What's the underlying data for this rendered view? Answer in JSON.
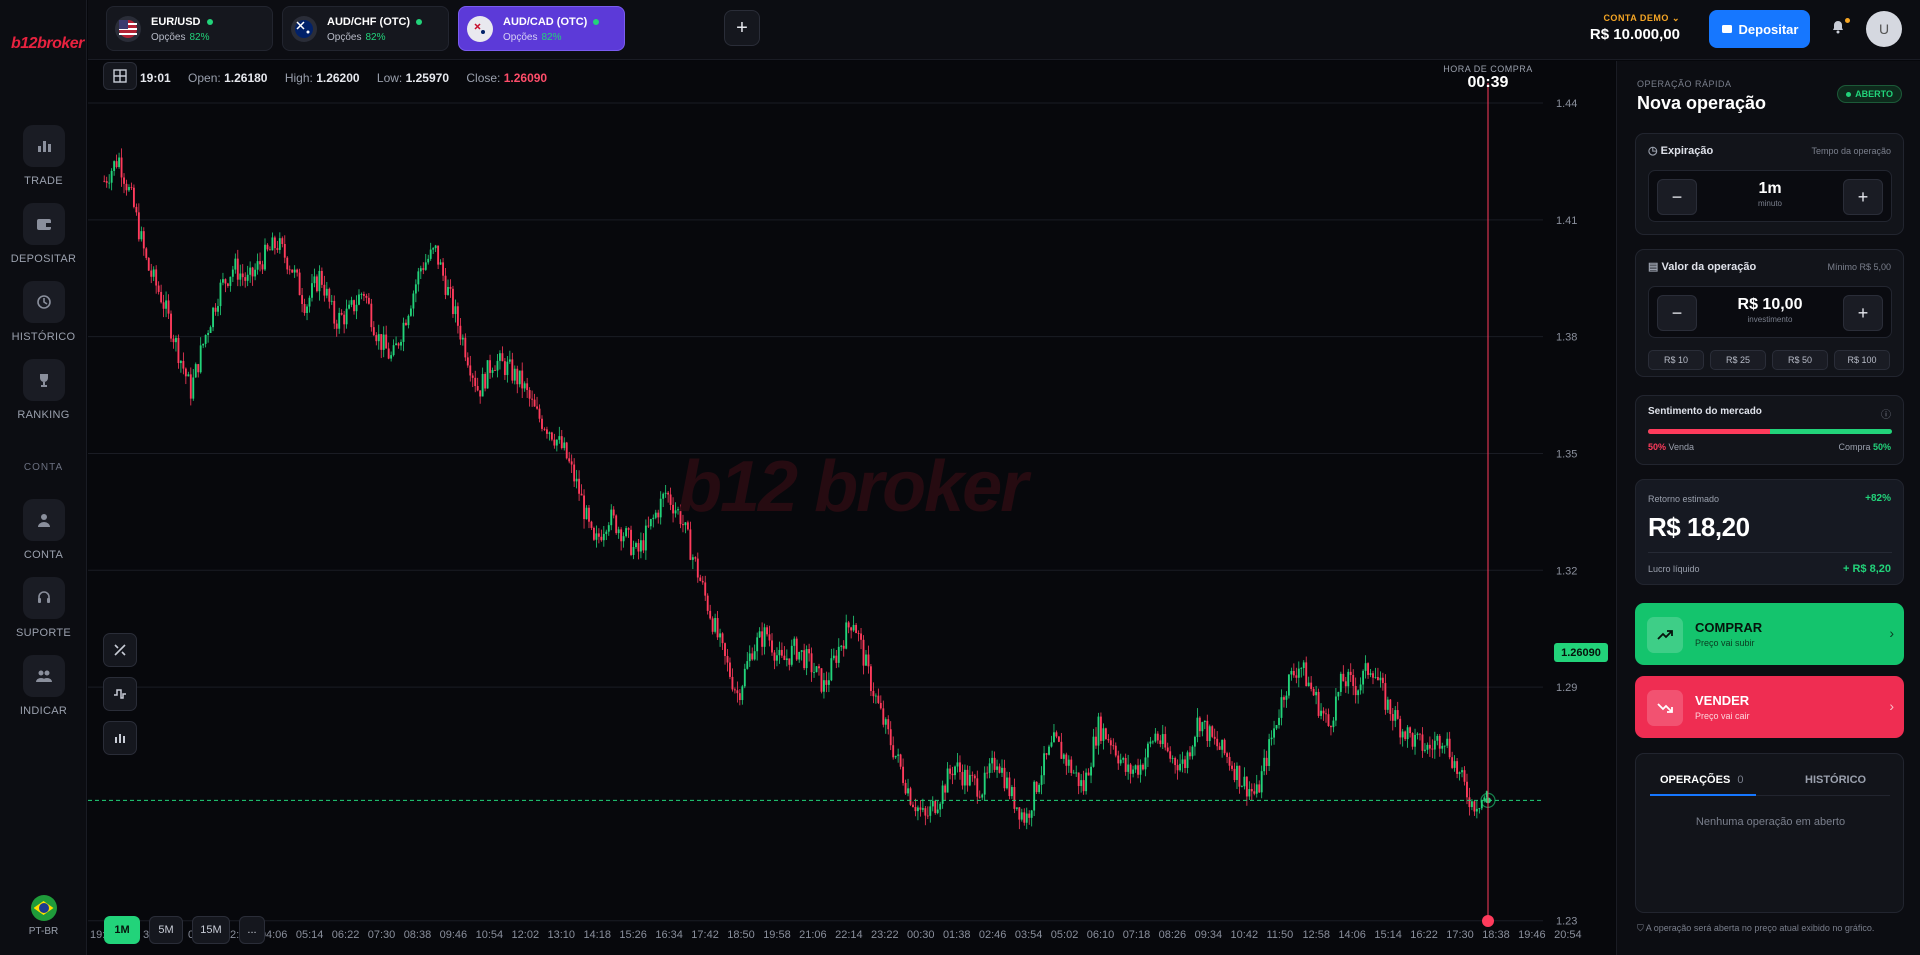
{
  "brand": {
    "logo": "b12broker",
    "watermark": "b12 broker"
  },
  "nav": {
    "items": [
      {
        "label": "TRADE",
        "icon": "bar-chart-icon"
      },
      {
        "label": "DEPOSITAR",
        "icon": "wallet-icon"
      },
      {
        "label": "HISTÓRICO",
        "icon": "history-icon"
      },
      {
        "label": "RANKING",
        "icon": "trophy-icon"
      }
    ],
    "section": "CONTA",
    "account_items": [
      {
        "label": "CONTA",
        "icon": "user-icon"
      },
      {
        "label": "SUPORTE",
        "icon": "headset-icon"
      },
      {
        "label": "INDICAR",
        "icon": "users-icon"
      }
    ],
    "language": "PT-BR"
  },
  "assets": [
    {
      "name": "EUR/USD",
      "sub": "Opções",
      "payout": "82%",
      "active": false
    },
    {
      "name": "AUD/CHF (OTC)",
      "sub": "Opções",
      "payout": "82%",
      "active": false
    },
    {
      "name": "AUD/CAD (OTC)",
      "sub": "Opções",
      "payout": "82%",
      "active": true
    }
  ],
  "header": {
    "demo_label": "CONTA DEMO",
    "balance": "R$ 10.000,00",
    "deposit_label": "Depositar",
    "avatar": "U"
  },
  "chart": {
    "ohlc": {
      "time": "19:01",
      "open_label": "Open:",
      "open": "1.26180",
      "high_label": "High:",
      "high": "1.26200",
      "low_label": "Low:",
      "low": "1.25970",
      "close_label": "Close:",
      "close": "1.26090"
    },
    "purchase_label": "HORA DE COMPRA",
    "purchase_time": "00:39",
    "current_price": "1.26090",
    "timeframes": [
      "1M",
      "5M",
      "15M",
      "..."
    ],
    "active_timeframe": "1M"
  },
  "chart_data": {
    "type": "candlestick",
    "y_ticks": [
      "1.44",
      "1.41",
      "1.38",
      "1.35",
      "1.32",
      "1.29",
      "1.23"
    ],
    "ylim": [
      1.23,
      1.44
    ],
    "x_ticks": [
      "19:",
      "0",
      "2",
      "32",
      "01:50",
      "02:58",
      "04:06",
      "05:14",
      "06:22",
      "07:30",
      "08:38",
      "09:46",
      "10:54",
      "12:02",
      "13:10",
      "14:18",
      "15:26",
      "16:34",
      "17:42",
      "18:50",
      "19:58",
      "21:06",
      "22:14",
      "23:22",
      "00:30",
      "01:38",
      "02:46",
      "03:54",
      "05:02",
      "06:10",
      "07:18",
      "08:26",
      "09:34",
      "10:42",
      "11:50",
      "12:58",
      "14:06",
      "15:14",
      "16:22",
      "17:30",
      "18:38",
      "19:46",
      "20:54"
    ],
    "price_path": [
      1.42,
      1.426,
      1.414,
      1.398,
      1.39,
      1.378,
      1.366,
      1.38,
      1.392,
      1.398,
      1.394,
      1.4,
      1.404,
      1.398,
      1.388,
      1.396,
      1.384,
      1.386,
      1.392,
      1.38,
      1.374,
      1.386,
      1.398,
      1.402,
      1.39,
      1.378,
      1.366,
      1.374,
      1.372,
      1.368,
      1.36,
      1.356,
      1.35,
      1.34,
      1.326,
      1.334,
      1.33,
      1.324,
      1.332,
      1.34,
      1.334,
      1.322,
      1.31,
      1.298,
      1.288,
      1.3,
      1.304,
      1.296,
      1.3,
      1.296,
      1.29,
      1.3,
      1.308,
      1.294,
      1.282,
      1.272,
      1.262,
      1.256,
      1.262,
      1.27,
      1.266,
      1.264,
      1.272,
      1.262,
      1.256,
      1.268,
      1.276,
      1.27,
      1.264,
      1.28,
      1.276,
      1.268,
      1.27,
      1.278,
      1.272,
      1.27,
      1.282,
      1.276,
      1.272,
      1.266,
      1.262,
      1.276,
      1.29,
      1.296,
      1.288,
      1.28,
      1.292,
      1.29,
      1.296,
      1.286,
      1.28,
      1.276,
      1.274,
      1.278,
      1.268,
      1.26,
      1.262
    ],
    "series": [
      {
        "values": []
      }
    ]
  },
  "panel": {
    "subtitle": "OPERAÇÃO RÁPIDA",
    "title": "Nova operação",
    "status": "ABERTO",
    "expiration": {
      "title": "Expiração",
      "hint": "Tempo da operação",
      "value": "1m",
      "unit": "minuto"
    },
    "amount": {
      "title": "Valor da operação",
      "hint": "Mínimo R$ 5,00",
      "value": "R$ 10,00",
      "unit": "investimento",
      "chips": [
        "R$ 10",
        "R$ 25",
        "R$ 50",
        "R$ 100"
      ]
    },
    "sentiment": {
      "title": "Sentimento do mercado",
      "sell_pct": "50%",
      "sell_label": "Venda",
      "buy_label": "Compra",
      "buy_pct": "50%",
      "sell_fraction": 0.5
    },
    "returns": {
      "title": "Retorno estimado",
      "pct": "+82%",
      "value": "R$ 18,20",
      "net_label": "Lucro líquido",
      "net_value": "+ R$ 8,20"
    },
    "buy": {
      "title": "COMPRAR",
      "sub": "Preço vai subir"
    },
    "sell": {
      "title": "VENDER",
      "sub": "Preço vai cair"
    },
    "tabs": {
      "operations": "OPERAÇÕES",
      "operations_count": "0",
      "history": "HISTÓRICO"
    },
    "empty": "Nenhuma operação em aberto",
    "footnote": "A operação será aberta no preço atual exibido no gráfico."
  },
  "colors": {
    "up": "#22d37a",
    "down": "#ff3b5c",
    "accent": "#1677ff",
    "active_tab": "#5c3ad8"
  }
}
